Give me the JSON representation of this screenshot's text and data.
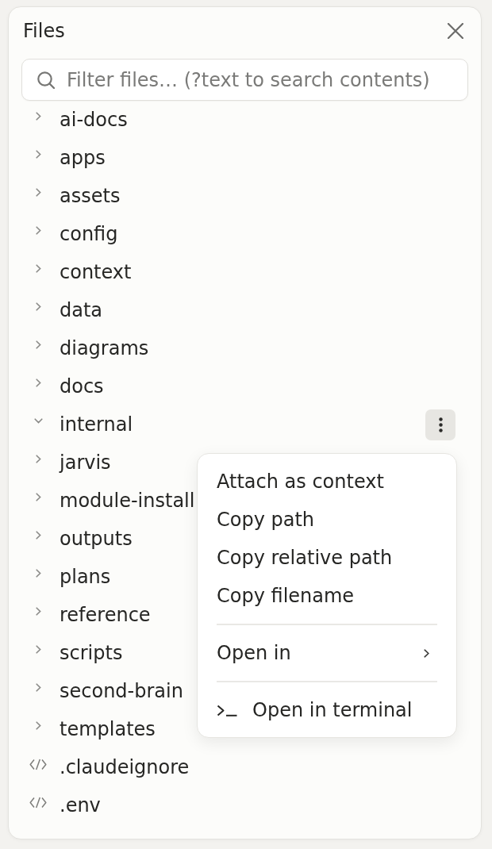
{
  "panel": {
    "title": "Files",
    "search": {
      "placeholder": "Filter files… (?text to search contents)"
    }
  },
  "tree": [
    {
      "kind": "folder",
      "name": "ai-docs",
      "expanded": false,
      "menu_open": false
    },
    {
      "kind": "folder",
      "name": "apps",
      "expanded": false,
      "menu_open": false
    },
    {
      "kind": "folder",
      "name": "assets",
      "expanded": false,
      "menu_open": false
    },
    {
      "kind": "folder",
      "name": "config",
      "expanded": false,
      "menu_open": false
    },
    {
      "kind": "folder",
      "name": "context",
      "expanded": false,
      "menu_open": false
    },
    {
      "kind": "folder",
      "name": "data",
      "expanded": false,
      "menu_open": false
    },
    {
      "kind": "folder",
      "name": "diagrams",
      "expanded": false,
      "menu_open": false
    },
    {
      "kind": "folder",
      "name": "docs",
      "expanded": false,
      "menu_open": false
    },
    {
      "kind": "folder",
      "name": "internal",
      "expanded": true,
      "menu_open": true
    },
    {
      "kind": "folder",
      "name": "jarvis",
      "expanded": false,
      "menu_open": false
    },
    {
      "kind": "folder",
      "name": "module-install",
      "expanded": false,
      "menu_open": false
    },
    {
      "kind": "folder",
      "name": "outputs",
      "expanded": false,
      "menu_open": false
    },
    {
      "kind": "folder",
      "name": "plans",
      "expanded": false,
      "menu_open": false
    },
    {
      "kind": "folder",
      "name": "reference",
      "expanded": false,
      "menu_open": false
    },
    {
      "kind": "folder",
      "name": "scripts",
      "expanded": false,
      "menu_open": false
    },
    {
      "kind": "folder",
      "name": "second-brain",
      "expanded": false,
      "menu_open": false
    },
    {
      "kind": "folder",
      "name": "templates",
      "expanded": false,
      "menu_open": false
    },
    {
      "kind": "file",
      "name": ".claudeignore",
      "menu_open": false
    },
    {
      "kind": "file",
      "name": ".env",
      "menu_open": false
    }
  ],
  "context_menu": {
    "items": [
      {
        "kind": "action",
        "label": "Attach as context"
      },
      {
        "kind": "action",
        "label": "Copy path"
      },
      {
        "kind": "action",
        "label": "Copy relative path"
      },
      {
        "kind": "action",
        "label": "Copy filename"
      },
      {
        "kind": "divider"
      },
      {
        "kind": "submenu",
        "label": "Open in"
      },
      {
        "kind": "divider"
      },
      {
        "kind": "terminal",
        "label": "Open in terminal"
      }
    ]
  }
}
